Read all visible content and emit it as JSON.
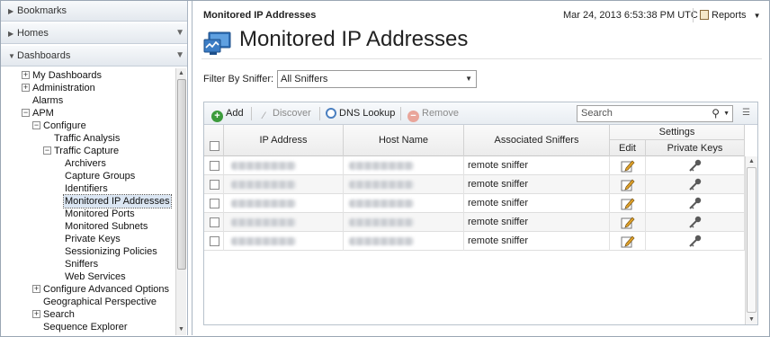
{
  "nav": {
    "bookmarks": "Bookmarks",
    "homes": "Homes",
    "dashboards": "Dashboards",
    "tree": {
      "my_dashboards": "My Dashboards",
      "administration": "Administration",
      "alarms": "Alarms",
      "apm": "APM",
      "configure": "Configure",
      "traffic_analysis": "Traffic Analysis",
      "traffic_capture": "Traffic Capture",
      "archivers": "Archivers",
      "capture_groups": "Capture Groups",
      "identifiers": "Identifiers",
      "monitored_ip_addresses": "Monitored IP Addresses",
      "monitored_ports": "Monitored Ports",
      "monitored_subnets": "Monitored Subnets",
      "private_keys": "Private Keys",
      "sessionizing_policies": "Sessionizing Policies",
      "sniffers": "Sniffers",
      "web_services": "Web Services",
      "configure_advanced_options": "Configure Advanced Options",
      "geographical_perspective": "Geographical Perspective",
      "search": "Search",
      "sequence_explorer": "Sequence Explorer"
    }
  },
  "header": {
    "breadcrumb": "Monitored IP Addresses",
    "timestamp": "Mar 24, 2013 6:53:38 PM UTC",
    "reports": "Reports",
    "title": "Monitored IP Addresses"
  },
  "filter": {
    "label": "Filter By Sniffer:",
    "value": "All Sniffers"
  },
  "toolbar": {
    "add": "Add",
    "discover": "Discover",
    "dns_lookup": "DNS Lookup",
    "remove": "Remove",
    "search_placeholder": "Search"
  },
  "table": {
    "columns": {
      "ip_address": "IP Address",
      "host_name": "Host Name",
      "associated_sniffers": "Associated Sniffers",
      "settings": "Settings",
      "edit": "Edit",
      "private_keys": "Private Keys"
    },
    "rows": [
      {
        "sniffer": "remote sniffer"
      },
      {
        "sniffer": "remote sniffer"
      },
      {
        "sniffer": "remote sniffer"
      },
      {
        "sniffer": "remote sniffer"
      },
      {
        "sniffer": "remote sniffer"
      }
    ]
  },
  "colors": {
    "accent": "#2f6fb6",
    "add_green": "#3c9b3c",
    "remove_red": "#e07a6b"
  }
}
